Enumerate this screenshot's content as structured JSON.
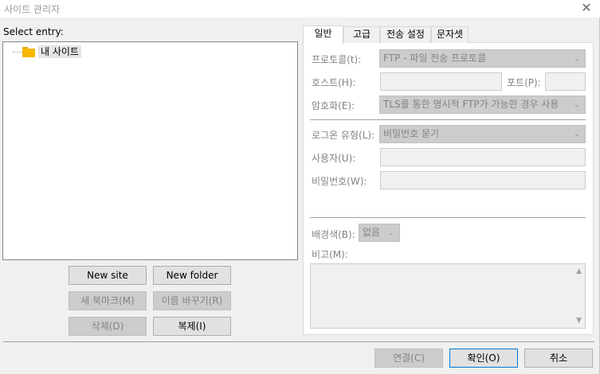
{
  "window": {
    "title": "사이트 관리자",
    "close_glyph": "✕"
  },
  "left": {
    "select_label": "Select entry:",
    "tree_root": "내 사이트",
    "buttons": {
      "new_site": "New site",
      "new_folder": "New folder",
      "new_bookmark": "새 북마크(M)",
      "rename": "이름 바꾸기(R)",
      "delete": "삭제(D)",
      "duplicate": "복제(I)"
    }
  },
  "tabs": [
    "일반",
    "고급",
    "전송 설정",
    "문자셋"
  ],
  "general": {
    "protocol_label": "프로토콜(t):",
    "protocol_value": "FTP - 파일 전송 프로토콜",
    "host_label": "호스트(H):",
    "host_value": "",
    "port_label": "포트(P):",
    "port_value": "",
    "encryption_label": "암호화(E):",
    "encryption_value": "TLS를 통한 명시적 FTP가 가능한 경우 사용",
    "logon_type_label": "로그온 유형(L):",
    "logon_type_value": "비밀번호 묻기",
    "user_label": "사용자(U):",
    "user_value": "",
    "password_label": "비밀번호(W):",
    "password_value": "",
    "background_label": "배경색(B):",
    "background_value": "없음",
    "comments_label": "비고(M):",
    "comments_value": ""
  },
  "footer": {
    "connect": "연결(C)",
    "ok": "확인(O)",
    "cancel": "취소"
  },
  "icons": {
    "dropdown": "chevron-down-icon",
    "folder": "folder-icon",
    "close": "close-icon"
  }
}
